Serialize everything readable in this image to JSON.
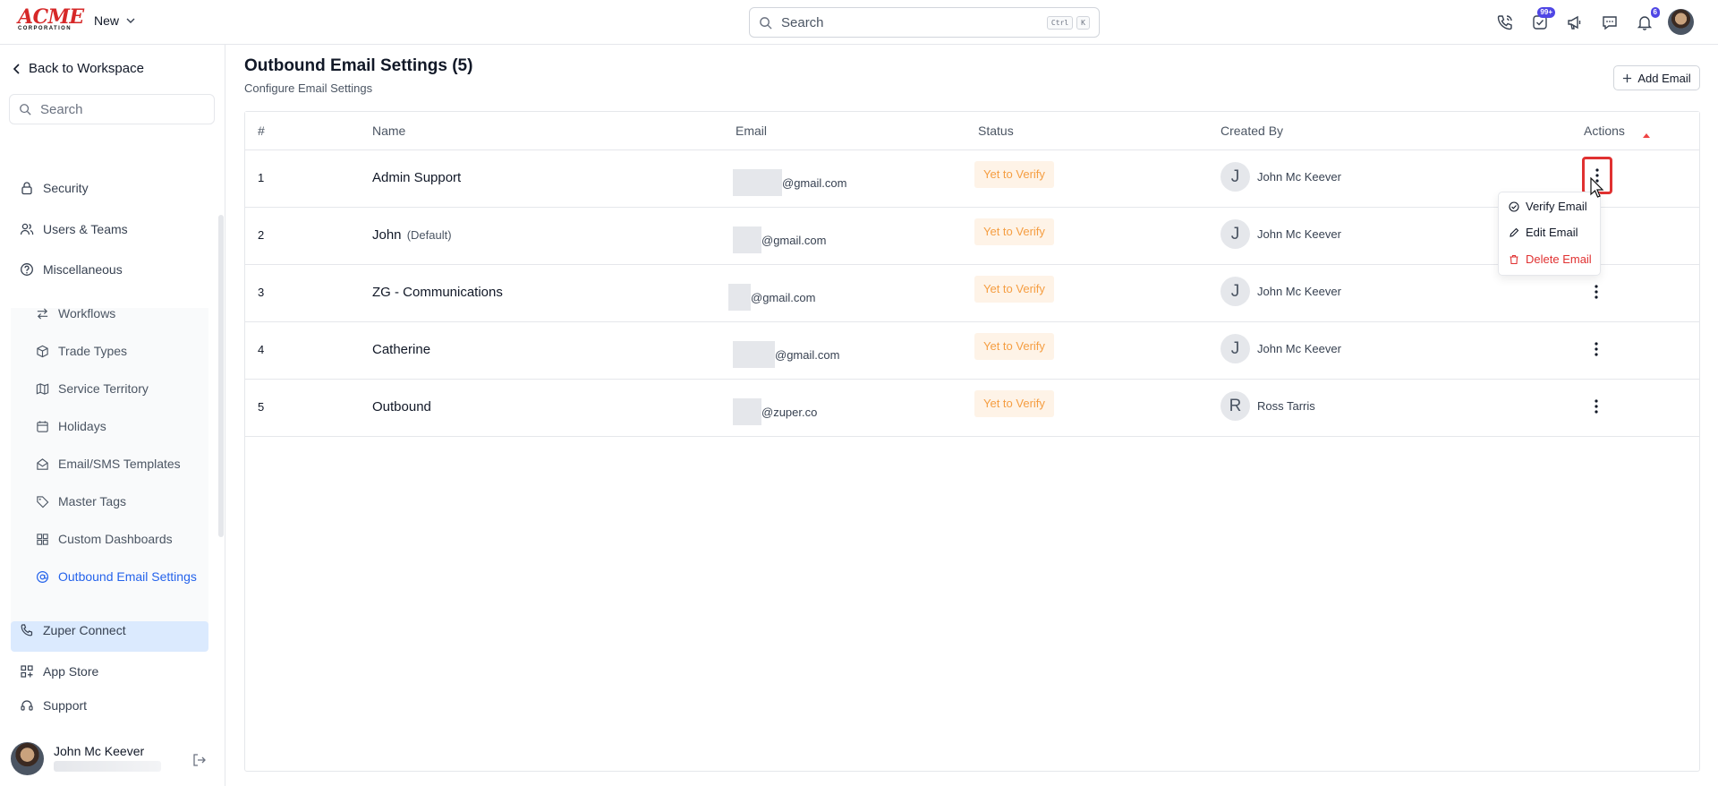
{
  "brand": {
    "logo_main": "ACME",
    "logo_sub": "CORPORATION"
  },
  "topbar": {
    "new_label": "New",
    "search_placeholder": "Search",
    "shortcut_keys": [
      "Ctrl",
      "K"
    ],
    "icons": [
      "phone-icon",
      "tasks-icon",
      "megaphone-icon",
      "chat-icon",
      "bell-icon"
    ],
    "tasks_badge": "99+",
    "notifications_badge": "6"
  },
  "sidebar": {
    "back_label": "Back to Workspace",
    "search_placeholder": "Search",
    "items": [
      {
        "label": "Security",
        "icon": "lock-icon"
      },
      {
        "label": "Users & Teams",
        "icon": "users-icon"
      },
      {
        "label": "Miscellaneous",
        "icon": "help-circle-icon",
        "expanded": true
      }
    ],
    "misc_items": [
      {
        "label": "Workflows",
        "icon": "workflow-icon"
      },
      {
        "label": "Trade Types",
        "icon": "box-icon"
      },
      {
        "label": "Service Territory",
        "icon": "map-icon"
      },
      {
        "label": "Holidays",
        "icon": "calendar-icon"
      },
      {
        "label": "Email/SMS Templates",
        "icon": "mail-open-icon"
      },
      {
        "label": "Master Tags",
        "icon": "tag-icon"
      },
      {
        "label": "Custom Dashboards",
        "icon": "dashboard-icon"
      },
      {
        "label": "Outbound Email Settings",
        "icon": "at-sign-icon",
        "active": true
      }
    ],
    "bottom_items": [
      {
        "label": "Zuper Connect",
        "icon": "phone-icon"
      },
      {
        "label": "App Store",
        "icon": "grid-icon"
      },
      {
        "label": "Support",
        "icon": "support-icon"
      }
    ],
    "user": {
      "name": "John Mc Keever"
    }
  },
  "main": {
    "title": "Outbound Email Settings (5)",
    "subtitle": "Configure Email Settings",
    "add_button": "Add Email",
    "columns": [
      "#",
      "Name",
      "Email",
      "Status",
      "Created By",
      "Actions"
    ],
    "rows": [
      {
        "num": "1",
        "name": "Admin Support",
        "name_suffix": "",
        "email_domain": "@gmail.com",
        "status": "Yet to Verify",
        "creator_initial": "J",
        "creator": "John Mc Keever"
      },
      {
        "num": "2",
        "name": "John",
        "name_suffix": "(Default)",
        "email_domain": "@gmail.com",
        "status": "Yet to Verify",
        "creator_initial": "J",
        "creator": "John Mc Keever"
      },
      {
        "num": "3",
        "name": "ZG - Communications",
        "name_suffix": "",
        "email_domain": "@gmail.com",
        "status": "Yet to Verify",
        "creator_initial": "J",
        "creator": "John Mc Keever"
      },
      {
        "num": "4",
        "name": "Catherine",
        "name_suffix": "",
        "email_domain": "@gmail.com",
        "status": "Yet to Verify",
        "creator_initial": "J",
        "creator": "John Mc Keever"
      },
      {
        "num": "5",
        "name": "Outbound",
        "name_suffix": "",
        "email_domain": "@zuper.co",
        "status": "Yet to Verify",
        "creator_initial": "R",
        "creator": "Ross Tarris"
      }
    ],
    "dropdown": {
      "items": [
        {
          "label": "Verify Email",
          "icon": "check-circle-icon"
        },
        {
          "label": "Edit Email",
          "icon": "pencil-icon"
        },
        {
          "label": "Delete Email",
          "icon": "trash-icon",
          "danger": true
        }
      ]
    }
  },
  "colors": {
    "accent": "#2563eb",
    "status_text": "#f59e42",
    "status_bg": "#fef3e7",
    "danger": "#e03131",
    "brand": "#d62828"
  }
}
